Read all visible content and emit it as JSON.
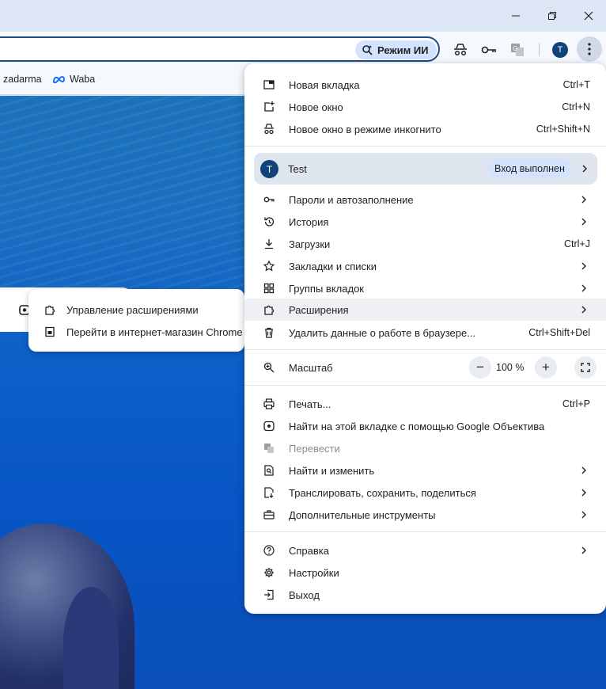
{
  "toolbar": {
    "ai_mode_label": "Режим ИИ",
    "avatar_letter": "T"
  },
  "bookmarks": [
    {
      "label": "zadarma"
    },
    {
      "label": "Waba"
    }
  ],
  "submenu": {
    "items": [
      {
        "label": "Управление расширениями",
        "icon": "puzzle-icon"
      },
      {
        "label": "Перейти в интернет-магазин Chrome",
        "icon": "store-icon"
      }
    ]
  },
  "menu": {
    "new_tab": {
      "label": "Новая вкладка",
      "shortcut": "Ctrl+T"
    },
    "new_window": {
      "label": "Новое окно",
      "shortcut": "Ctrl+N"
    },
    "incognito": {
      "label": "Новое окно в режиме инкогнито",
      "shortcut": "Ctrl+Shift+N"
    },
    "profile": {
      "letter": "T",
      "name": "Test",
      "status": "Вход выполнен"
    },
    "passwords": {
      "label": "Пароли и автозаполнение"
    },
    "history": {
      "label": "История"
    },
    "downloads": {
      "label": "Загрузки",
      "shortcut": "Ctrl+J"
    },
    "bookmarks": {
      "label": "Закладки и списки"
    },
    "tab_groups": {
      "label": "Группы вкладок"
    },
    "extensions": {
      "label": "Расширения"
    },
    "clear_data": {
      "label": "Удалить данные о работе в браузере...",
      "shortcut": "Ctrl+Shift+Del"
    },
    "zoom": {
      "label": "Масштаб",
      "value": "100 %",
      "minus": "−",
      "plus": "+"
    },
    "print": {
      "label": "Печать...",
      "shortcut": "Ctrl+P"
    },
    "lens": {
      "label": "Найти на этой вкладке с помощью Google Объектива"
    },
    "translate": {
      "label": "Перевести"
    },
    "find": {
      "label": "Найти и изменить"
    },
    "cast": {
      "label": "Транслировать, сохранить, поделиться"
    },
    "more_tools": {
      "label": "Дополнительные инструменты"
    },
    "help": {
      "label": "Справка"
    },
    "settings": {
      "label": "Настройки"
    },
    "exit": {
      "label": "Выход"
    }
  }
}
